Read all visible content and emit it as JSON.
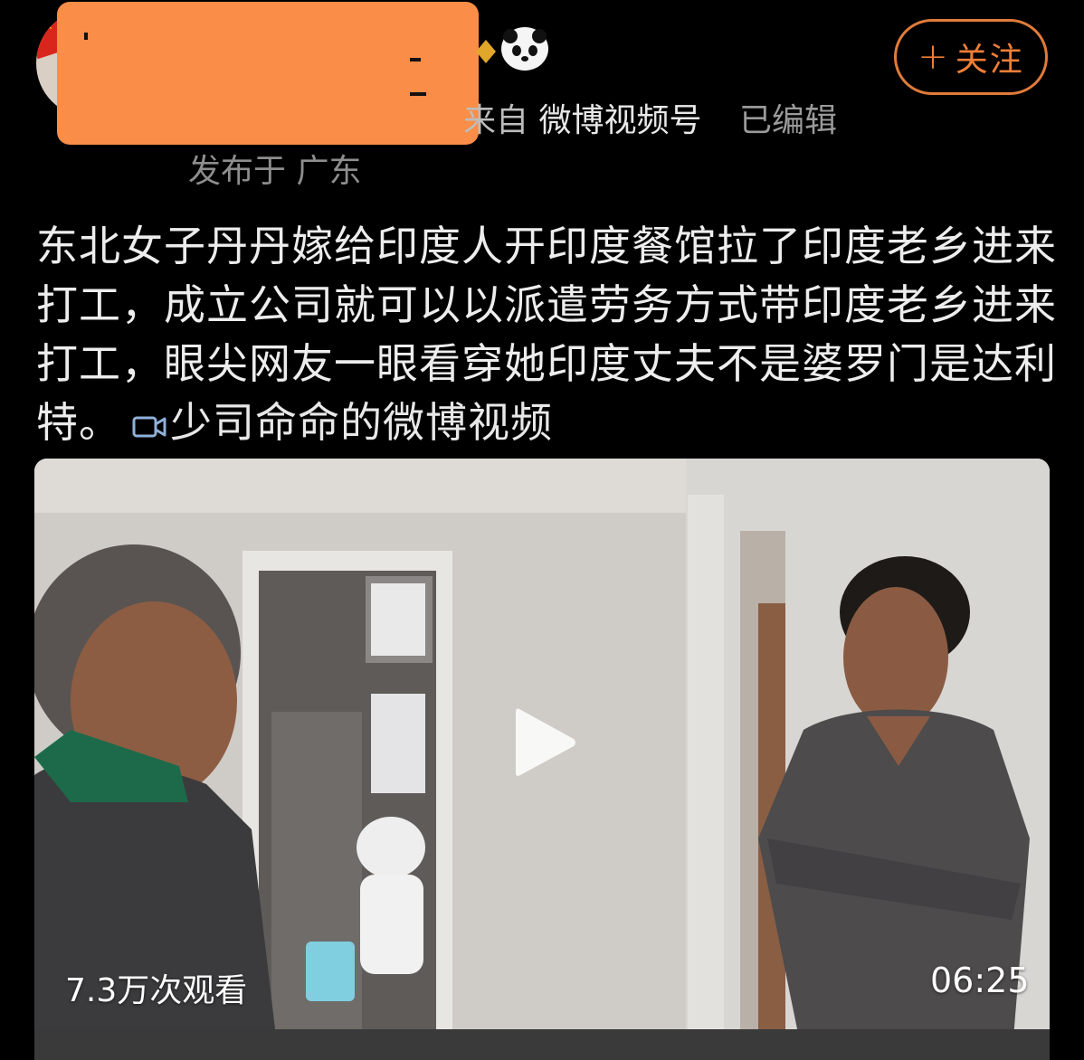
{
  "header": {
    "follow_label": "关注",
    "follow_plus": "+",
    "source_prefix": "来自",
    "source_name": "微博视频号",
    "edited": "已编辑",
    "location": "发布于 广东"
  },
  "post": {
    "text": "东北女子丹丹嫁给印度人开印度餐馆拉了印度老乡进来打工，成立公司就可以以派遣劳务方式带印度老乡进来打工，眼尖网友一眼看穿她印度丈夫不是婆罗门是达利特。",
    "video_link_label": "少司命命的微博视频"
  },
  "video": {
    "views": "7.3万次观看",
    "duration": "06:25"
  },
  "colors": {
    "accent": "#f07f36",
    "redaction": "#fa8d47",
    "background": "#000000"
  },
  "icons": [
    "flag-avatar",
    "gold-badge-icon",
    "panda-icon",
    "video-camera-icon",
    "play-icon"
  ]
}
